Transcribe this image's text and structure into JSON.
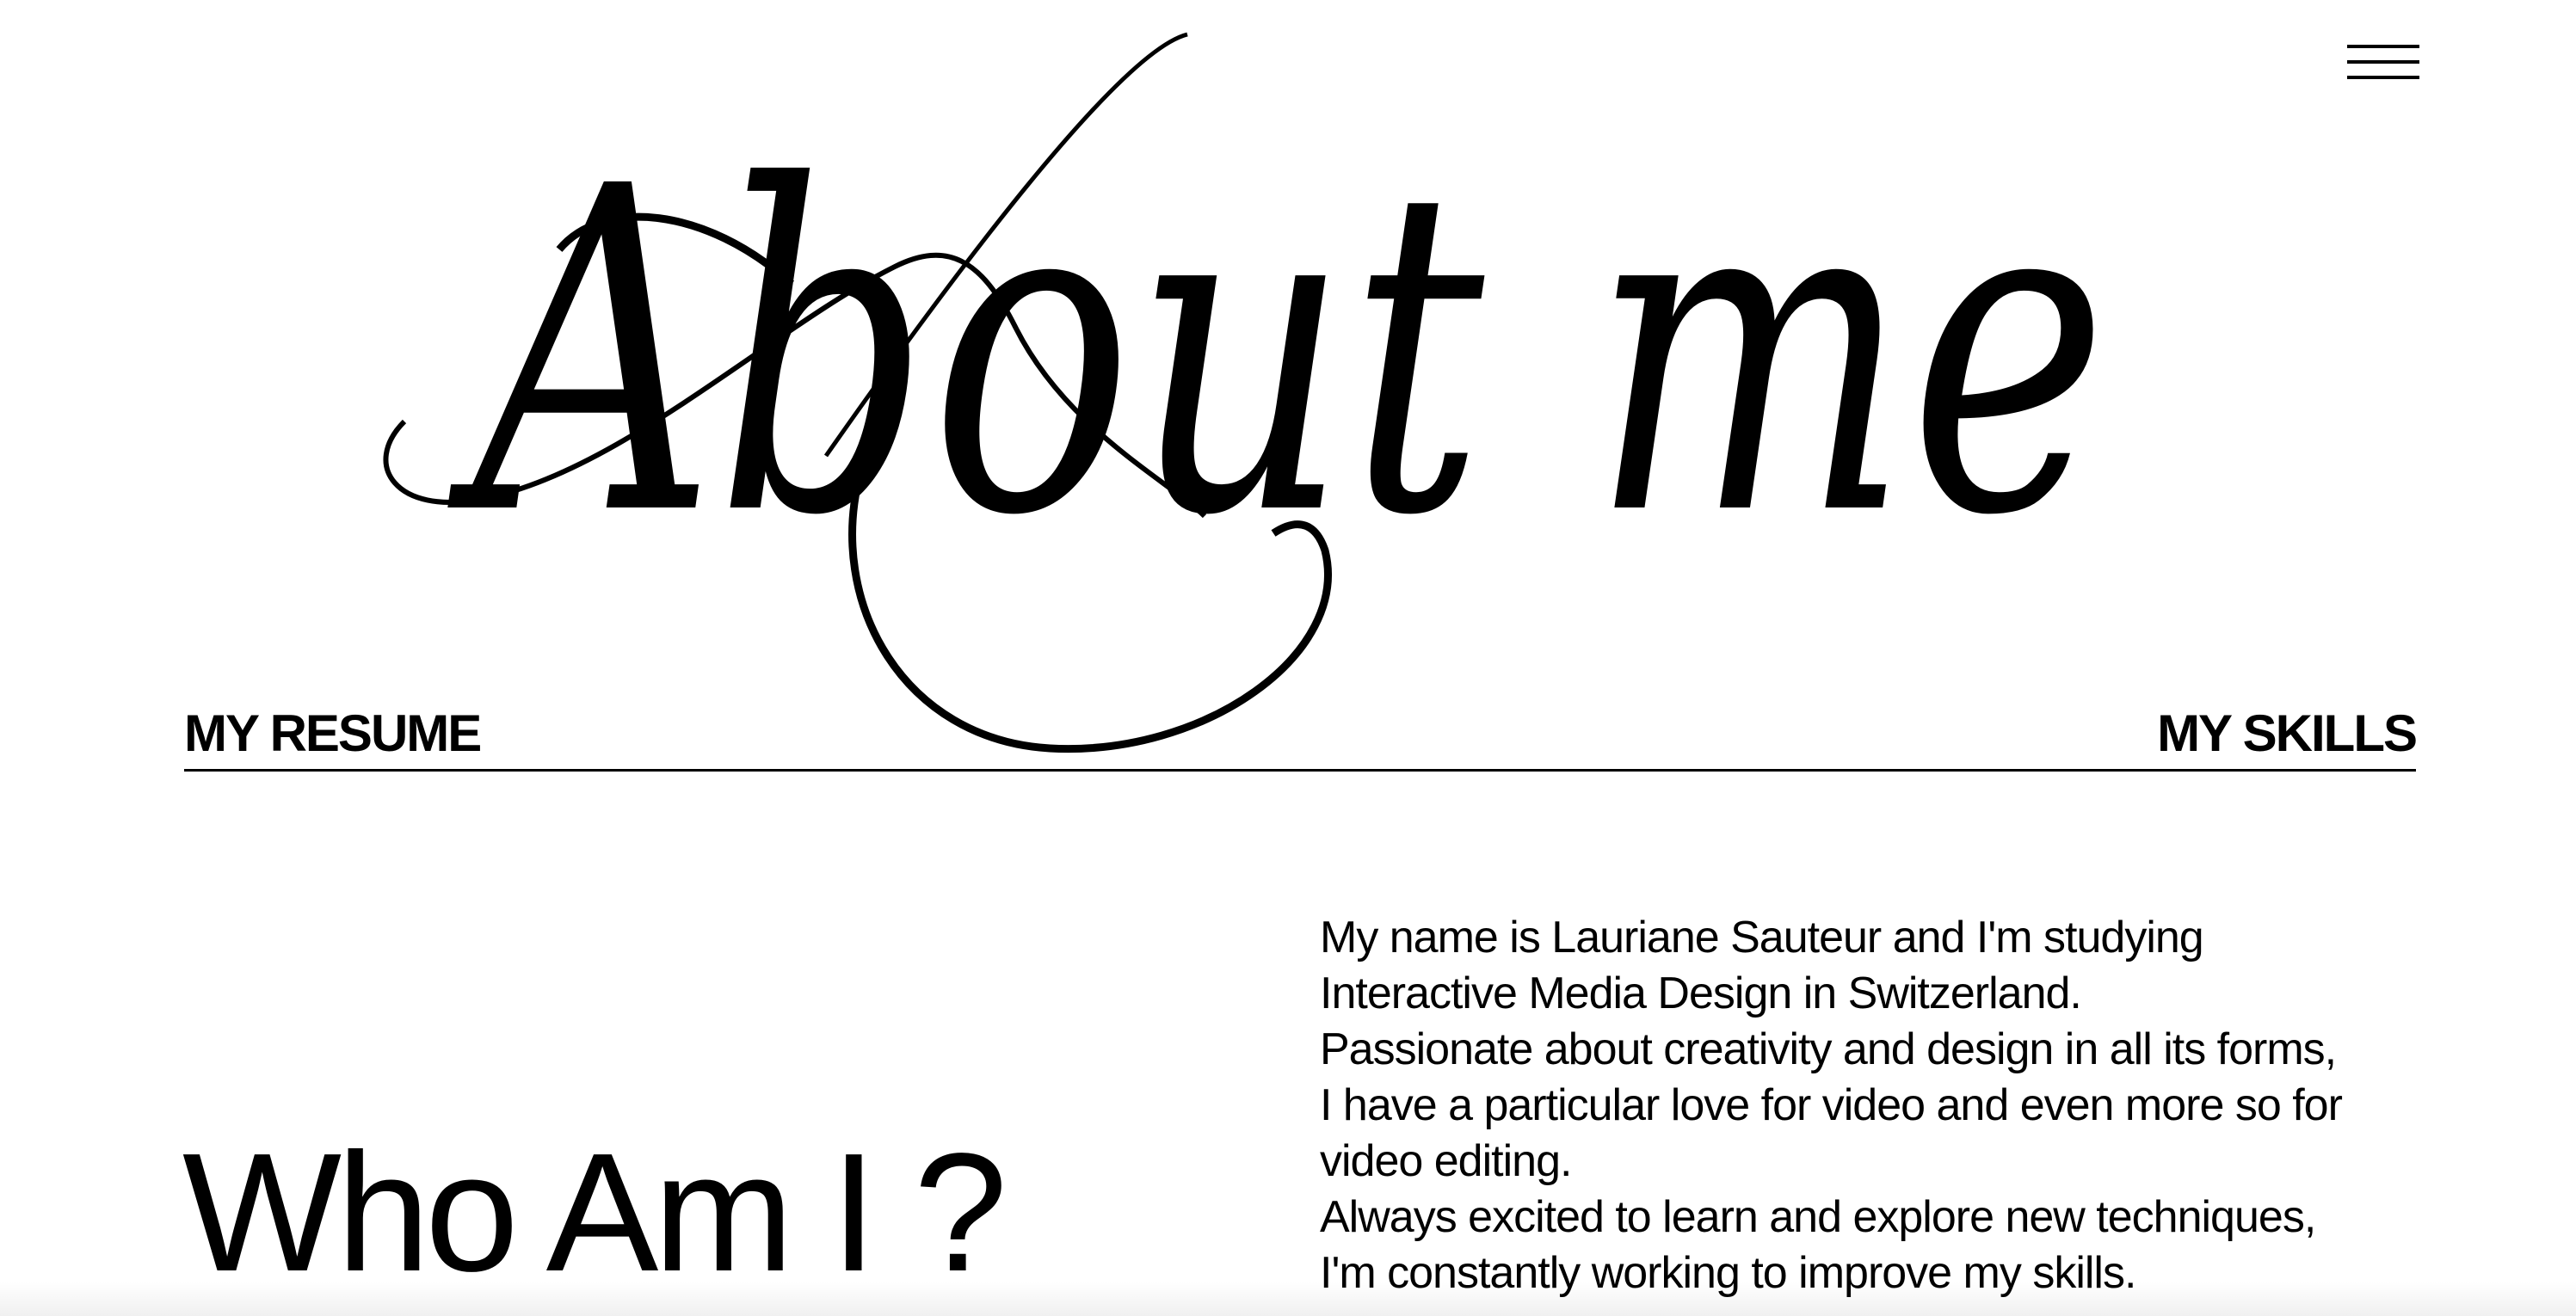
{
  "header": {
    "menu_icon": "hamburger-menu-icon",
    "title": "About me"
  },
  "nav": {
    "resume_label": "MY RESUME",
    "skills_label": "MY SKILLS"
  },
  "main": {
    "heading": "Who Am I ?",
    "bio_lines": [
      "My name is Lauriane Sauteur and I'm studying",
      "Interactive Media Design in Switzerland.",
      "Passionate about creativity and design in all its forms,",
      "I have a particular love for video and even more so for",
      "video editing.",
      "Always excited to learn and explore new techniques,",
      "I'm constantly working to improve my skills."
    ]
  },
  "colors": {
    "background": "#ffffff",
    "text": "#000000"
  }
}
